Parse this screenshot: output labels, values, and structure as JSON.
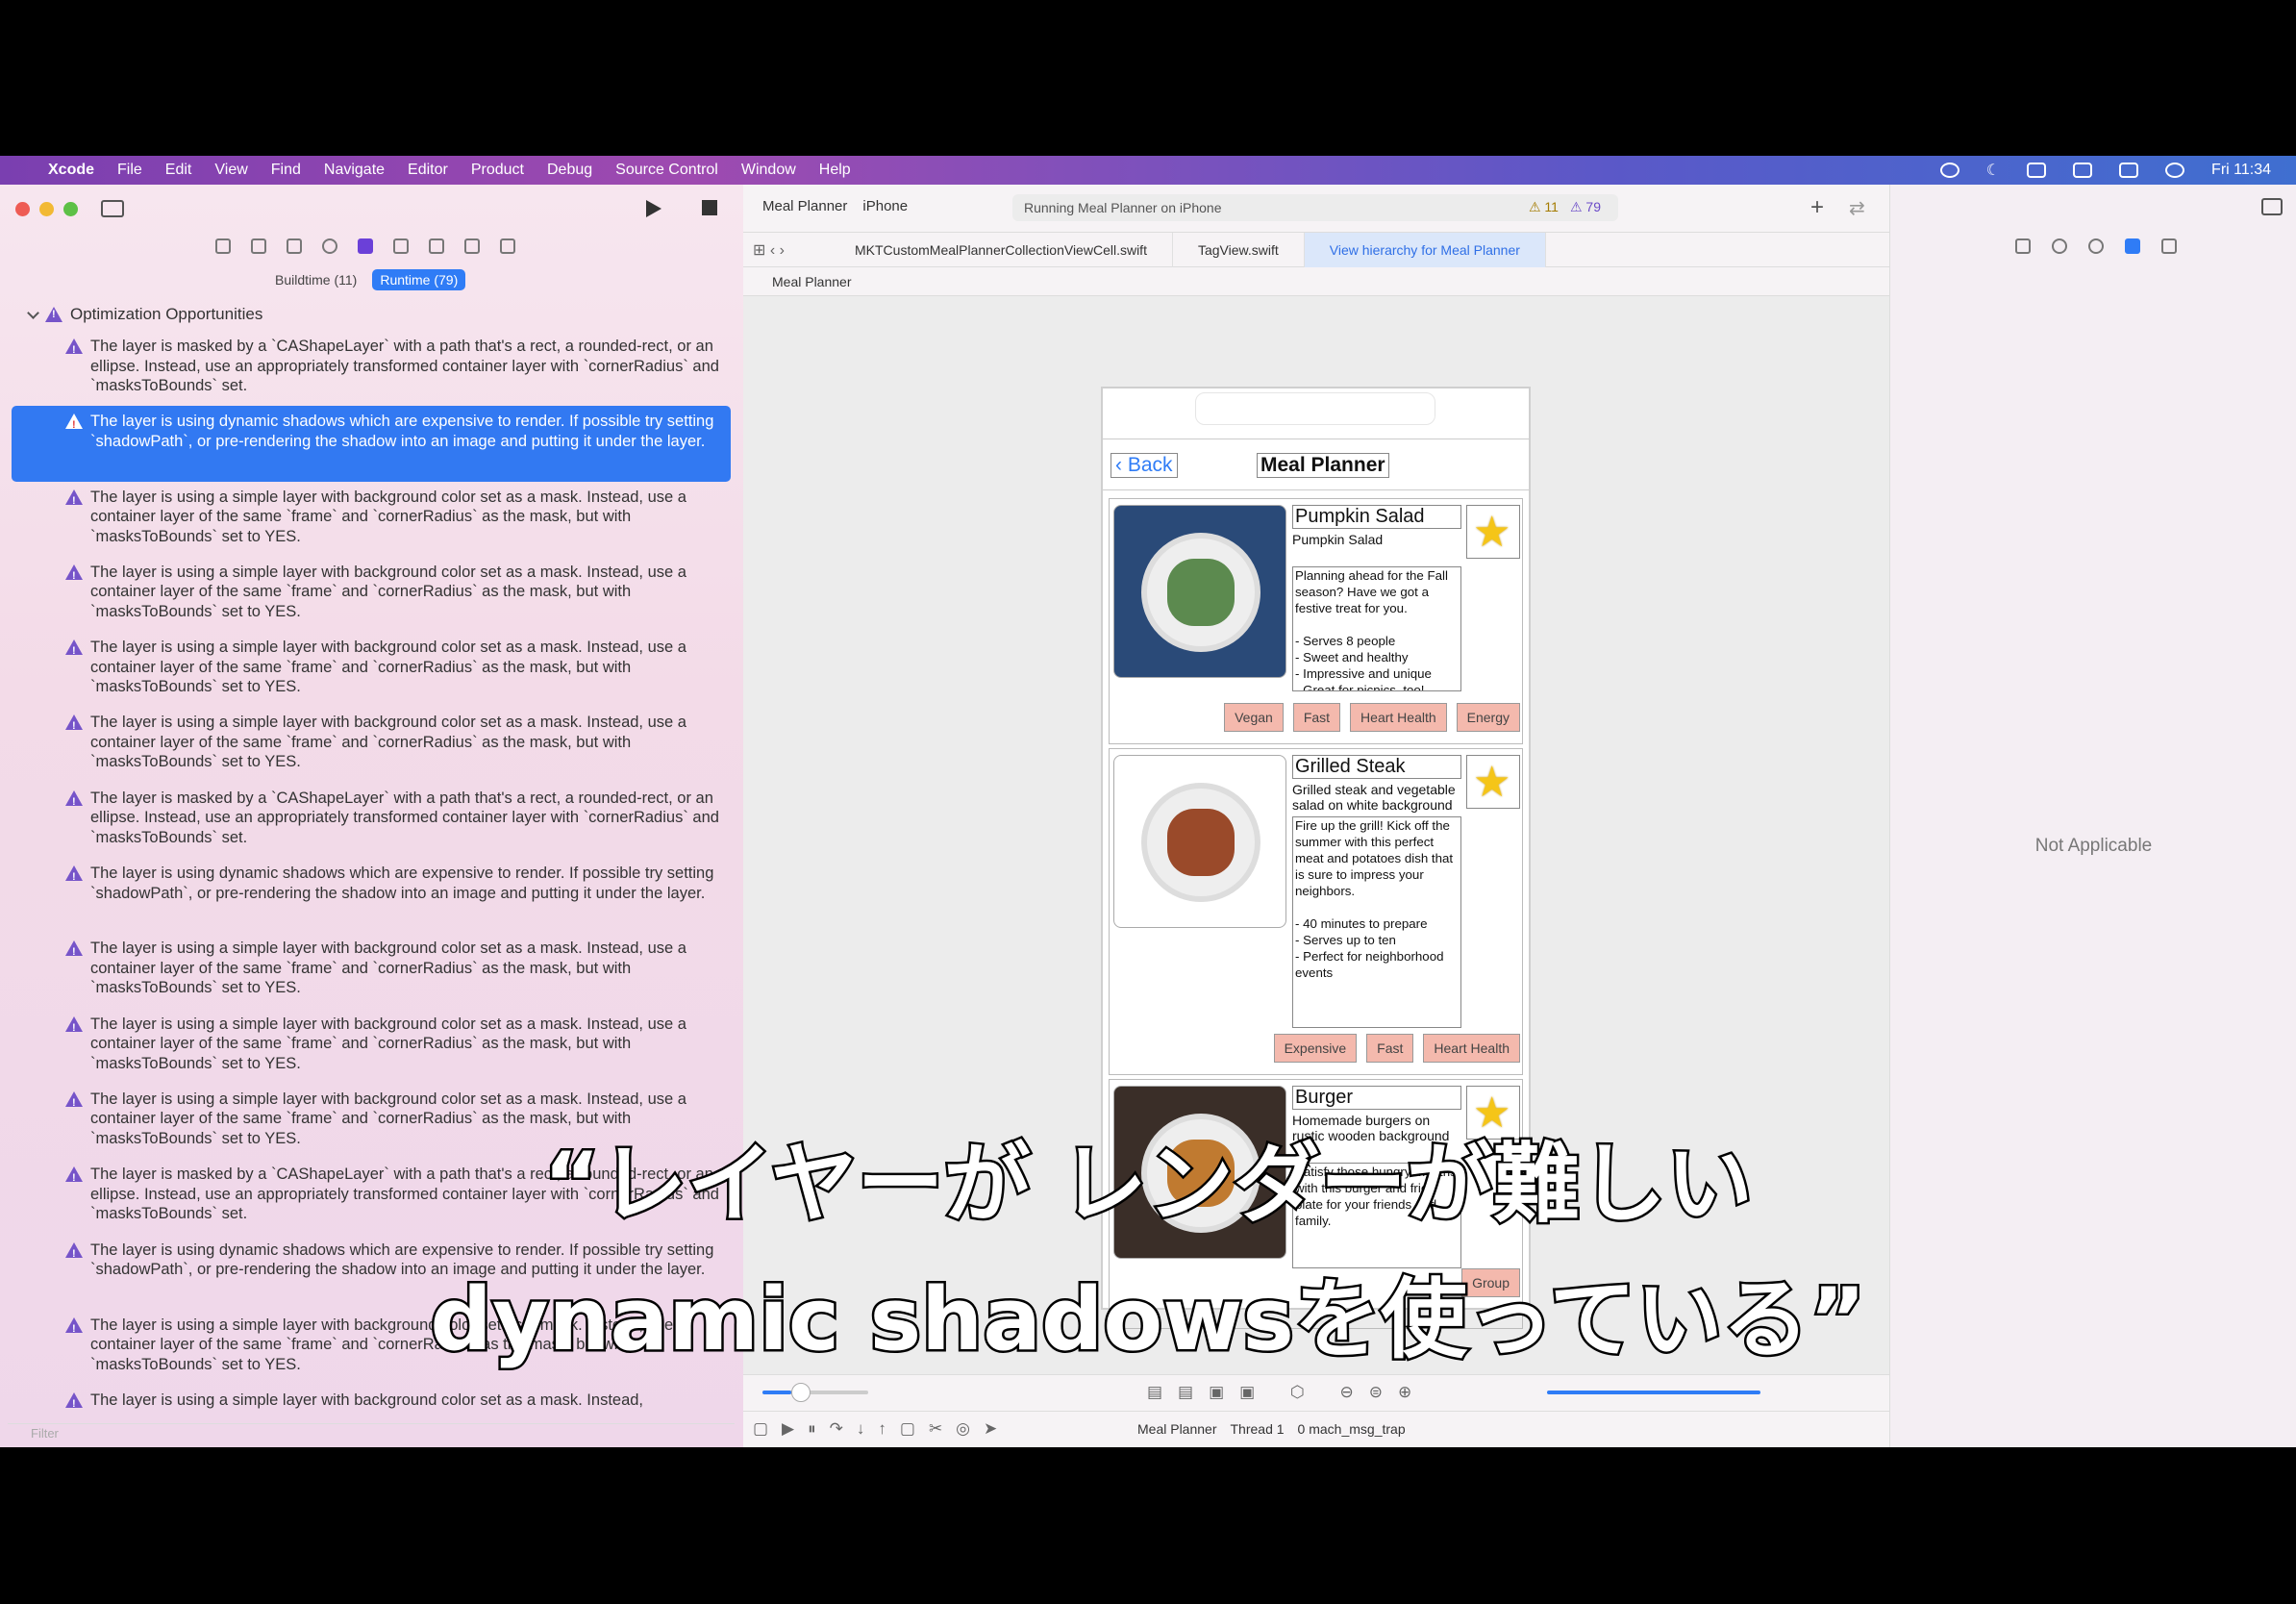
{
  "menubar": {
    "app": "Xcode",
    "items": [
      "File",
      "Edit",
      "View",
      "Find",
      "Navigate",
      "Editor",
      "Product",
      "Debug",
      "Source Control",
      "Window",
      "Help"
    ],
    "clock": "Fri 11:34"
  },
  "navigator": {
    "segments": {
      "buildtime": "Buildtime (11)",
      "runtime": "Runtime (79)"
    },
    "group_title": "Optimization Opportunities",
    "issues": [
      {
        "text": "The layer is masked by a `CAShapeLayer` with a path that's a rect, a rounded-rect, or an ellipse. Instead, use an appropriately transformed container layer with `cornerRadius` and `masksToBounds` set."
      },
      {
        "text": "The layer is using dynamic shadows which are expensive to render. If possible try setting `shadowPath`, or pre-rendering the shadow into an image and putting it under the layer.",
        "selected": true
      },
      {
        "text": "The layer is using a simple layer with background color set as a mask. Instead, use a container layer of the same `frame` and `cornerRadius` as the mask, but with `masksToBounds` set to YES."
      },
      {
        "text": "The layer is using a simple layer with background color set as a mask. Instead, use a container layer of the same `frame` and `cornerRadius` as the mask, but with `masksToBounds` set to YES."
      },
      {
        "text": "The layer is using a simple layer with background color set as a mask. Instead, use a container layer of the same `frame` and `cornerRadius` as the mask, but with `masksToBounds` set to YES."
      },
      {
        "text": "The layer is using a simple layer with background color set as a mask. Instead, use a container layer of the same `frame` and `cornerRadius` as the mask, but with `masksToBounds` set to YES."
      },
      {
        "text": "The layer is masked by a `CAShapeLayer` with a path that's a rect, a rounded-rect, or an ellipse. Instead, use an appropriately transformed container layer with `cornerRadius` and `masksToBounds` set."
      },
      {
        "text": "The layer is using dynamic shadows which are expensive to render. If possible try setting `shadowPath`, or pre-rendering the shadow into an image and putting it under the layer."
      },
      {
        "text": "The layer is using a simple layer with background color set as a mask. Instead, use a container layer of the same `frame` and `cornerRadius` as the mask, but with `masksToBounds` set to YES."
      },
      {
        "text": "The layer is using a simple layer with background color set as a mask. Instead, use a container layer of the same `frame` and `cornerRadius` as the mask, but with `masksToBounds` set to YES."
      },
      {
        "text": "The layer is using a simple layer with background color set as a mask. Instead, use a container layer of the same `frame` and `cornerRadius` as the mask, but with `masksToBounds` set to YES."
      },
      {
        "text": "The layer is masked by a `CAShapeLayer` with a path that's a rect, a rounded-rect, or an ellipse. Instead, use an appropriately transformed container layer with `cornerRadius` and `masksToBounds` set."
      },
      {
        "text": "The layer is using dynamic shadows which are expensive to render. If possible try setting `shadowPath`, or pre-rendering the shadow into an image and putting it under the layer."
      },
      {
        "text": "The layer is using a simple layer with background color set as a mask. Instead, use a container layer of the same `frame` and `cornerRadius` as the mask, but with `masksToBounds` set to YES."
      },
      {
        "text": "The layer is using a simple layer with background color set as a mask. Instead,"
      }
    ],
    "filter_placeholder": "Filter"
  },
  "toolbar": {
    "scheme": "Meal Planner",
    "device": "iPhone",
    "status": "Running Meal Planner on iPhone",
    "warnings": "11",
    "runtime_issues": "79"
  },
  "tabs": [
    {
      "label": "MKTCustomMealPlannerCollectionViewCell.swift"
    },
    {
      "label": "TagView.swift"
    },
    {
      "label": "View hierarchy for Meal Planner",
      "active": true
    }
  ],
  "jumpbar": {
    "item": "Meal Planner"
  },
  "app": {
    "back_label": "Back",
    "title": "Meal Planner",
    "meals": [
      {
        "title": "Pumpkin Salad",
        "subtitle": "Pumpkin Salad",
        "description": "Planning ahead for the Fall season? Have we got a festive treat for you.\n\n- Serves 8 people\n- Sweet and healthy\n- Impressive and unique\n- Great for picnics, too!",
        "tags": [
          "Vegan",
          "Fast",
          "Heart Health",
          "Energy"
        ]
      },
      {
        "title": "Grilled Steak",
        "subtitle": "Grilled steak and vegetable salad on white background",
        "description": "Fire up the grill! Kick off the summer with this perfect meat and potatoes dish that is sure to impress your neighbors.\n\n- 40 minutes to prepare\n- Serves up to ten\n- Perfect for neighborhood events",
        "tags": [
          "Expensive",
          "Fast",
          "Heart Health"
        ]
      },
      {
        "title": "Burger",
        "subtitle": "Homemade burgers on rustic wooden background",
        "description": "Satisfy those hungry mouths with this burger and fries plate for your friends and family.",
        "tags": [
          "Group"
        ]
      }
    ]
  },
  "debugbar": {
    "crumbs": [
      "Meal Planner",
      "Thread 1",
      "0 mach_msg_trap"
    ]
  },
  "inspector": {
    "empty_text": "Not Applicable"
  },
  "subtitles": {
    "line1": "“レイヤーが レンダーが難しい",
    "line2": "dynamic shadowsを使っている”"
  }
}
